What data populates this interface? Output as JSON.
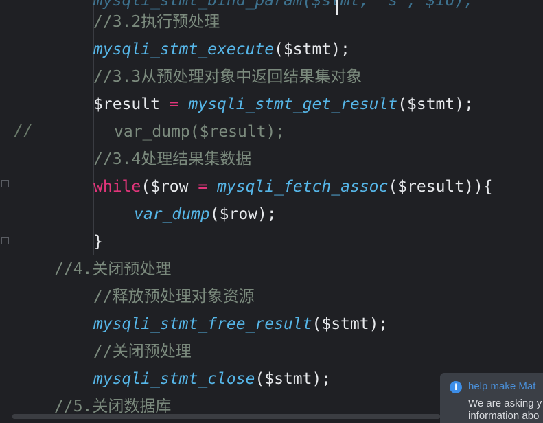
{
  "editor": {
    "lines": [
      {
        "kind": "partial",
        "text": "mysqli_stmt_bind_param($stmt, \"s\", $id);"
      },
      {
        "kind": "comment",
        "text": "//3.2执行预处理"
      },
      {
        "kind": "call",
        "fn": "mysqli_stmt_execute",
        "args": "($stmt);"
      },
      {
        "kind": "comment",
        "text": "//3.3从预处理对象中返回结果集对象"
      },
      {
        "kind": "assign",
        "var": "$result",
        "op": "=",
        "fn": "mysqli_stmt_get_result",
        "args": "($stmt);"
      },
      {
        "kind": "commented",
        "text": "var_dump($result);"
      },
      {
        "kind": "comment",
        "text": "//3.4处理结果集数据"
      },
      {
        "kind": "while",
        "kw": "while",
        "open": "(",
        "var": "$row",
        "op": "=",
        "fn": "mysqli_fetch_assoc",
        "args": "($result)){"
      },
      {
        "kind": "call",
        "fn": "var_dump",
        "args": "($row);"
      },
      {
        "kind": "brace",
        "text": "}"
      },
      {
        "kind": "comment",
        "text": "//4.关闭预处理"
      },
      {
        "kind": "comment",
        "text": "//释放预处理对象资源"
      },
      {
        "kind": "call",
        "fn": "mysqli_stmt_free_result",
        "args": "($stmt);"
      },
      {
        "kind": "comment",
        "text": "//关闭预处理"
      },
      {
        "kind": "call",
        "fn": "mysqli_stmt_close",
        "args": "($stmt);"
      },
      {
        "kind": "comment",
        "text": "//5.关闭数据库"
      }
    ],
    "gutter_comment": "//"
  },
  "notification": {
    "icon": "info-icon",
    "title": "help make Mat",
    "body_line1": "We are asking y",
    "body_line2": "information abo"
  }
}
